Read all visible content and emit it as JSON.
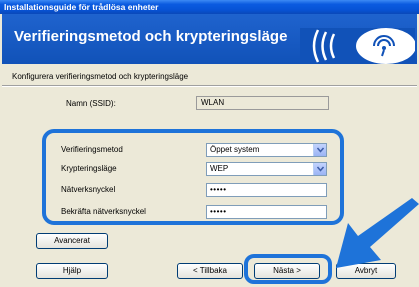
{
  "window": {
    "title": "Installationsguide för trådlösa enheter",
    "header_title": "Verifieringsmetod och krypteringsläge"
  },
  "form": {
    "subtitle": "Konfigurera verifieringsmetod och krypteringsläge",
    "ssid_label": "Namn (SSID):",
    "ssid_value": "WLAN",
    "auth_label": "Verifieringsmetod",
    "auth_value": "Öppet system",
    "encryption_label": "Krypteringsläge",
    "encryption_value": "WEP",
    "key_label": "Nätverksnyckel",
    "key_value": "•••••",
    "confirm_label": "Bekräfta nätverksnyckel",
    "confirm_value": "•••••"
  },
  "buttons": {
    "advanced": "Avancerat",
    "help": "Hjälp",
    "back": "< Tillbaka",
    "next": "Nästa >",
    "cancel": "Avbryt"
  },
  "colors": {
    "highlight": "#1e73d9",
    "header_bg": "#1152b8"
  },
  "icons": {
    "header": "wifi-signal-icon",
    "pointer": "big-arrow-icon"
  }
}
